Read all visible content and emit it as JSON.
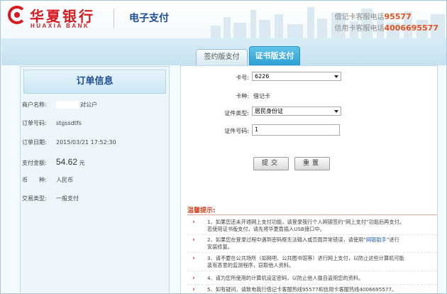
{
  "header": {
    "bank_name_cn": "华夏银行",
    "bank_name_en": "HUAXIA BANK",
    "page_title": "电子支付",
    "hotline_debit_label": "借记卡客服电话",
    "hotline_debit_number": "95577",
    "hotline_credit_label": "信用卡客服电话",
    "hotline_credit_number": "4006695577"
  },
  "tabs": [
    {
      "label": "签约版支付",
      "active": false
    },
    {
      "label": "证书版支付",
      "active": true
    }
  ],
  "order": {
    "title": "订单信息",
    "rows": [
      {
        "label": "商户名称:",
        "value": "对公户"
      },
      {
        "label": "订单号码:",
        "value": "stgssdtfs"
      },
      {
        "label": "订单日期:",
        "value": "2015/03/21 17:52:30"
      },
      {
        "label": "支付金额:",
        "value": "54.62",
        "unit": "元"
      },
      {
        "label": "币　　种:",
        "value": "人民币"
      },
      {
        "label": "交易类型:",
        "value": "一般支付"
      }
    ]
  },
  "form": {
    "card_no_label": "卡号:",
    "card_no_value": "6226",
    "card_type_label": "卡种:",
    "card_type_value": "借记卡",
    "id_type_label": "证件类型:",
    "id_type_value": "居民身份证",
    "id_no_label": "证件号码:",
    "id_no_value": "1",
    "submit_label": "提交",
    "reset_label": "重置"
  },
  "tips": {
    "title": "温馨提示:",
    "items": [
      {
        "lines": [
          "1、如果您还未开通网上支付功能，请登录我行个人网银签约“网上支付”功能后再支付。",
          "若使用证书版支付，请先将华夏盾插入USB接口中。"
        ]
      },
      {
        "pre": "2、如果您在登录过程中遇到密码框无法输入或页面异常错误，请使用“",
        "link": "网银助手",
        "post": "”进行",
        "line2": "安装修复。"
      },
      {
        "lines": [
          "3、请不要在公共场所（如网吧、公共图书馆等）进行网上支付，以防止这些计算机可能",
          "装有恶意的监测程序，窃取他人资料。"
        ]
      },
      {
        "lines": [
          "4、请为您所使用的计算机设定密码，以防止他人擅自盗用您的资料。"
        ]
      },
      {
        "lines": [
          "5、如有疑问，请致电我行借记卡客服热线95577和信用卡客服热线4006695577。"
        ]
      }
    ]
  },
  "colors": {
    "brand_red": "#d71920",
    "title_blue": "#1f4e92",
    "active_tab": "#2b9fd3",
    "hotline_orange": "#e7501f"
  }
}
